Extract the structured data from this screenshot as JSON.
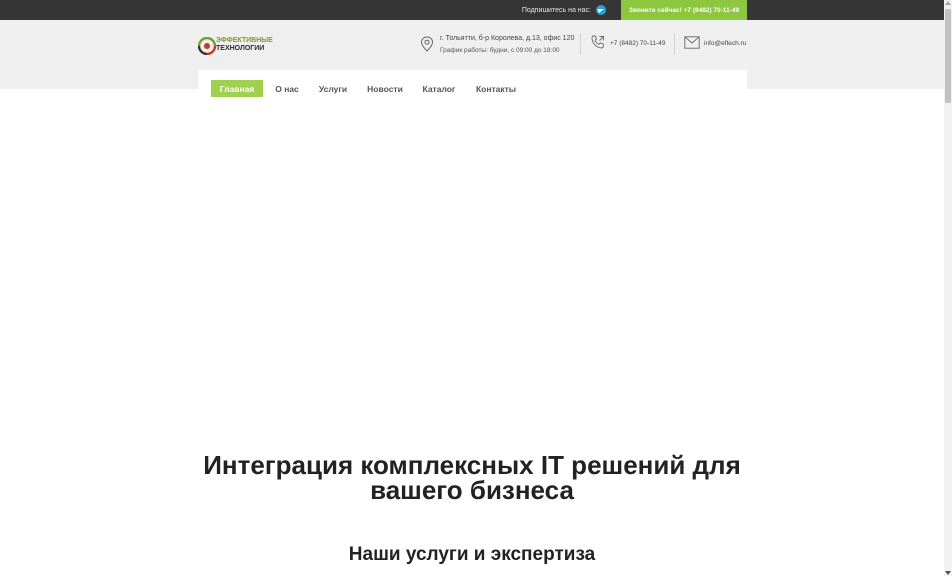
{
  "topbar": {
    "subscribe_label": "Подпишитесь на нас:",
    "call_button": "Звоните сейчас! +7 (8482) 70-11-49"
  },
  "logo": {
    "line1": "ЭФФЕКТИВНЫЕ",
    "line2": "ТЕХНОЛОГИИ"
  },
  "contacts": {
    "address": "г. Тольятти, б-р Королева, д.13, офис 120",
    "hours": "График работы: будни, с 09:00 до 18:00",
    "phone": "+7 (8482) 70-11-49",
    "email": "info@eftech.ru"
  },
  "nav": {
    "items": [
      {
        "label": "Главная",
        "active": true
      },
      {
        "label": "О нас"
      },
      {
        "label": "Услуги"
      },
      {
        "label": "Новости"
      },
      {
        "label": "Каталог"
      },
      {
        "label": "Контакты"
      }
    ]
  },
  "hero": {
    "title": "Интеграция комплексных IT решений для вашего бизнеса"
  },
  "services": {
    "title": "Наши услуги и экспертиза"
  },
  "colors": {
    "topbar": "#353535",
    "accent_green": "#8dc63f",
    "nav_active": "#9fd14f",
    "header_band": "#efefef",
    "telegram": "#2aa3db"
  },
  "icons": [
    "telegram-icon",
    "location-pin-icon",
    "phone-icon",
    "mail-icon"
  ]
}
